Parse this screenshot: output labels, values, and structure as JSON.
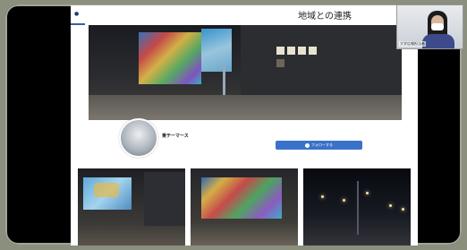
{
  "slide": {
    "logo_text": "●",
    "title": "地域との連携"
  },
  "webcam": {
    "name_tag": "大学広報担当者"
  },
  "profile": {
    "page_name": "東テーマース",
    "page_sub": "",
    "follow_button_label": "フォローする",
    "follow_note": ""
  },
  "colors": {
    "accent": "#3b72c9",
    "header_rule": "#3a5fa8"
  }
}
